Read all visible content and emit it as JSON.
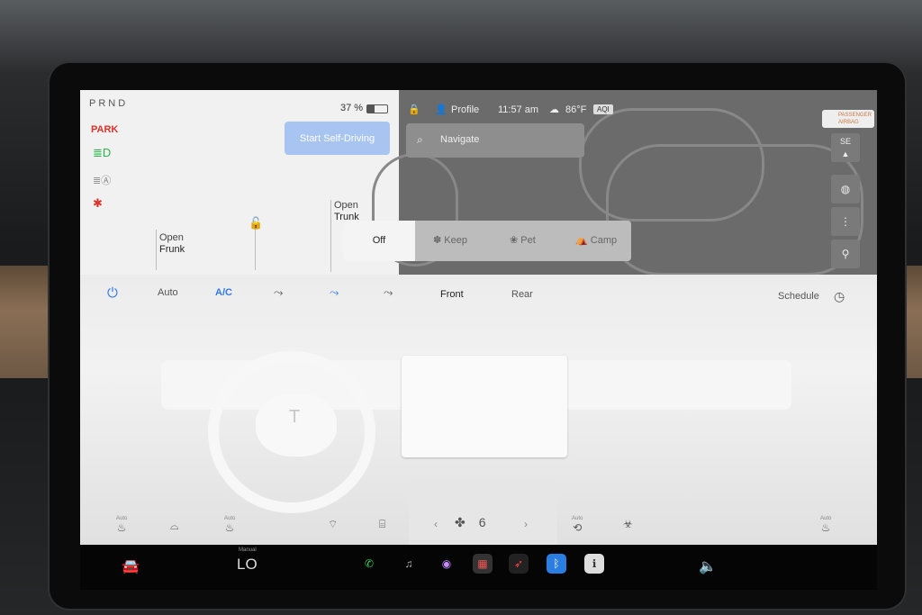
{
  "gear": {
    "prnd": "PRND",
    "park": "PARK"
  },
  "battery": {
    "percent_text": "37 %",
    "fill_fraction": 0.37
  },
  "self_driving_label": "Start Self-Driving",
  "frunk": {
    "action": "Open",
    "name": "Frunk"
  },
  "trunk": {
    "action": "Open",
    "name": "Trunk"
  },
  "status": {
    "profile": "Profile",
    "time": "11:57 am",
    "temp": "86°F",
    "aqi": "AQI"
  },
  "navigate_placeholder": "Navigate",
  "airbag": {
    "line1": "PASSENGER",
    "line2": "AIRBAG"
  },
  "compass": "SE",
  "climate_modes": [
    {
      "label": "Off",
      "selected": true
    },
    {
      "label": "Keep",
      "selected": false
    },
    {
      "label": "Pet",
      "selected": false
    },
    {
      "label": "Camp",
      "selected": false
    }
  ],
  "climate": {
    "auto": "Auto",
    "ac": "A/C",
    "front": "Front",
    "rear": "Rear",
    "schedule": "Schedule",
    "fan_speed": "6",
    "seat_auto_label": "Auto"
  },
  "dock": {
    "temp_mode": "Manual",
    "temp_value": "LO"
  },
  "colors": {
    "accent_blue": "#2f79e8",
    "park_red": "#e0312b",
    "headlight_green": "#2bb24c"
  }
}
